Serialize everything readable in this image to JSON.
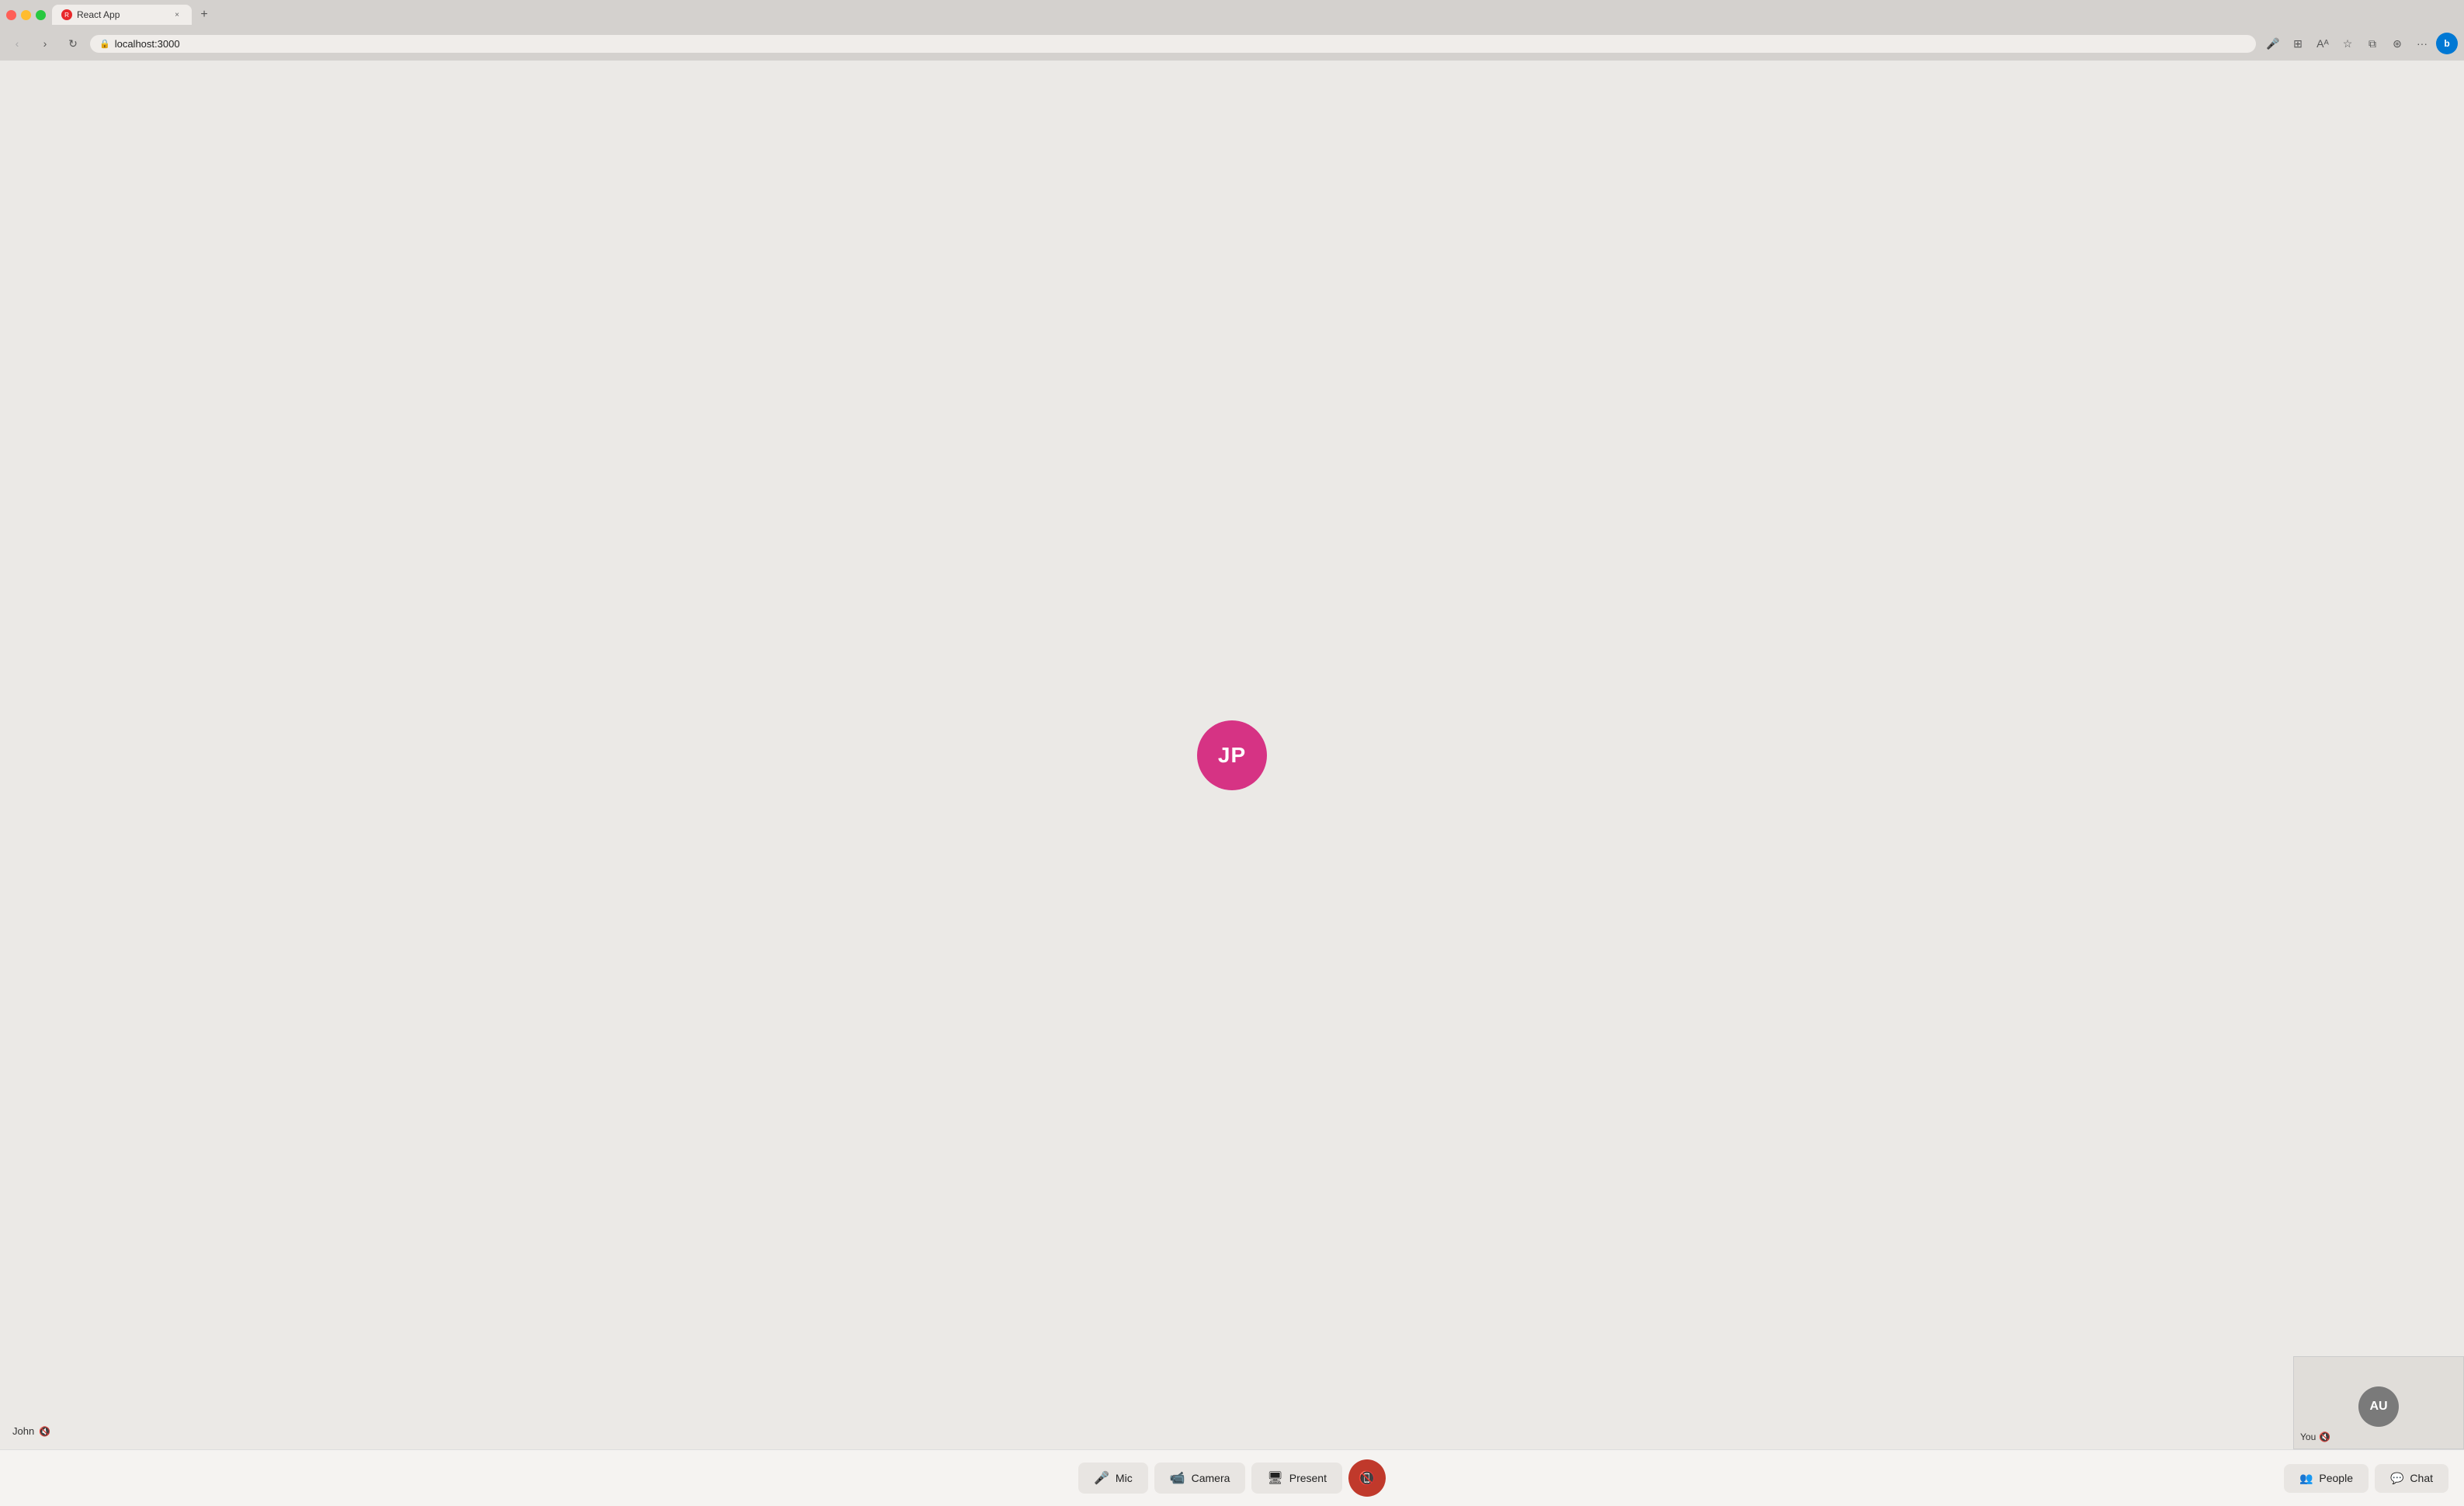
{
  "browser": {
    "tab_title": "React App",
    "url": "localhost:3000",
    "close_label": "×",
    "new_tab_label": "+"
  },
  "nav": {
    "back_label": "‹",
    "forward_label": "›",
    "refresh_label": "↻"
  },
  "toolbar": {
    "mic_icon": "🎤",
    "grid_icon": "⊞",
    "font_icon": "A",
    "star_icon": "☆",
    "split_icon": "⧉",
    "extensions_icon": "⊕",
    "more_icon": "…",
    "bing_icon": "b"
  },
  "main_participant": {
    "initials": "JP",
    "name": "John",
    "avatar_color": "#d63384",
    "muted": true
  },
  "self_view": {
    "initials": "AU",
    "label": "You",
    "muted": true,
    "avatar_color": "#7a7a7a"
  },
  "bottom_bar": {
    "mic_label": "Mic",
    "camera_label": "Camera",
    "present_label": "Present",
    "people_label": "People",
    "chat_label": "Chat"
  }
}
